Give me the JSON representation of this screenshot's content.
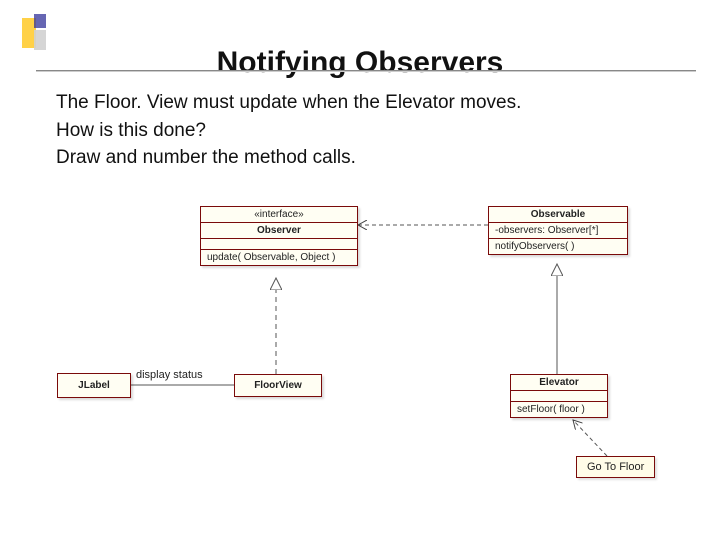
{
  "title": "Notifying Observers",
  "body": {
    "line1": "The Floor. View must update when the Elevator moves.",
    "line2": "How is this done?",
    "line3": "Draw and number the method calls."
  },
  "uml": {
    "observer": {
      "stereotype": "«interface»",
      "name": "Observer",
      "op": "update( Observable, Object )"
    },
    "observable": {
      "name": "Observable",
      "attr": "-observers: Observer[*]",
      "op": "notifyObservers( )"
    },
    "jlabel": {
      "name": "JLabel"
    },
    "floorview": {
      "name": "FloorView"
    },
    "elevator": {
      "name": "Elevator",
      "op": "setFloor( floor )"
    },
    "assoc_label": "display status"
  },
  "button": {
    "go": "Go To Floor"
  }
}
